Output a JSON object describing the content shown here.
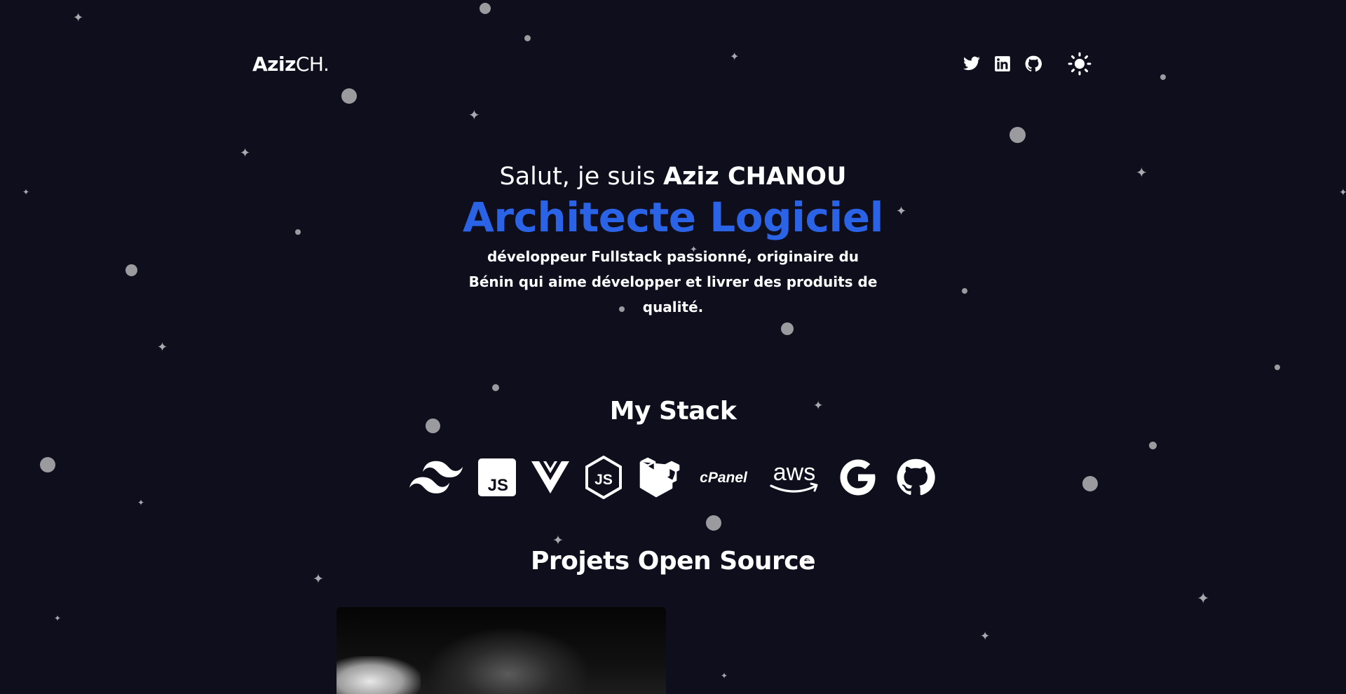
{
  "header": {
    "logo_bold": "Aziz",
    "logo_light": "CH.",
    "icons": [
      "twitter-icon",
      "linkedin-icon",
      "github-icon"
    ],
    "theme_icon": "sun-icon"
  },
  "hero": {
    "greeting_prefix": "Salut, je suis ",
    "name": "Aziz CHANOU",
    "role": "Architecte Logiciel",
    "description": "développeur Fullstack passionné, originaire du Bénin qui aime développer et livrer des produits de qualité."
  },
  "stack": {
    "title": "My Stack",
    "items": [
      "tailwind-icon",
      "javascript-icon",
      "vue-icon",
      "nodejs-icon",
      "laravel-icon",
      "cpanel-icon",
      "aws-icon",
      "google-icon",
      "github-icon"
    ],
    "cpanel_text": "cPanel",
    "aws_text": "aws",
    "js_text": "JS"
  },
  "projects": {
    "title": "Projets Open Source"
  },
  "colors": {
    "background": "#0f0e1d",
    "accent": "#2b63e6",
    "text": "#ffffff"
  }
}
